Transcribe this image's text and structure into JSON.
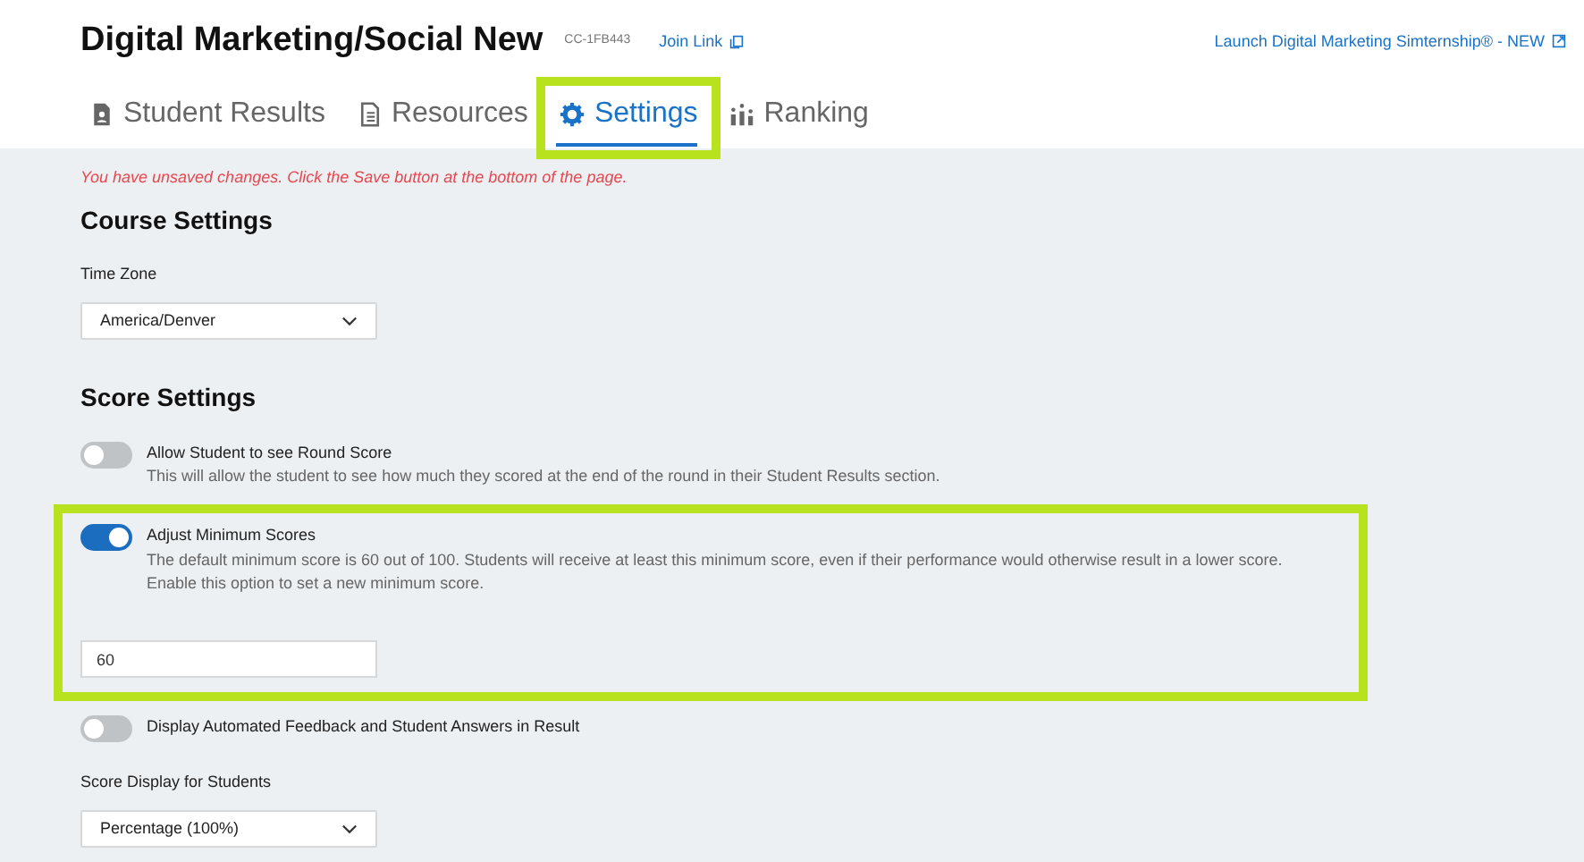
{
  "header": {
    "title": "Digital Marketing/Social New",
    "code": "CC-1FB443",
    "join_link": "Join Link",
    "launch_link": "Launch Digital Marketing Simternship® - NEW"
  },
  "tabs": [
    {
      "label": "Student Results",
      "selected": false,
      "highlighted": false
    },
    {
      "label": "Resources",
      "selected": false,
      "highlighted": false
    },
    {
      "label": "Settings",
      "selected": true,
      "highlighted": true
    },
    {
      "label": "Ranking",
      "selected": false,
      "highlighted": false
    }
  ],
  "warning": "You have unsaved changes. Click the Save button at the bottom of the page.",
  "course_settings": {
    "heading": "Course Settings",
    "fields": [
      {
        "kind": "select",
        "label": "Time Zone",
        "value": "America/Denver"
      }
    ]
  },
  "score_settings": {
    "heading": "Score Settings",
    "items": [
      {
        "kind": "toggle",
        "label": "Allow Student to see Round Score",
        "on": false,
        "highlighted": false,
        "description": "This will allow the student to see how much they scored at the end of the round in their Student Results section."
      },
      {
        "kind": "toggle",
        "label": "Adjust Minimum Scores",
        "on": true,
        "highlighted": true,
        "description": "The default minimum score is 60 out of 100. Students will receive at least this minimum score, even if their performance would otherwise result in a lower score. Enable this option to set a new minimum score.",
        "input_value": "60"
      },
      {
        "kind": "toggle",
        "label": "Display Automated Feedback and Student Answers in Result",
        "on": false,
        "highlighted": false
      },
      {
        "kind": "select",
        "label": "Score Display for Students",
        "value": "Percentage (100%)"
      }
    ]
  }
}
